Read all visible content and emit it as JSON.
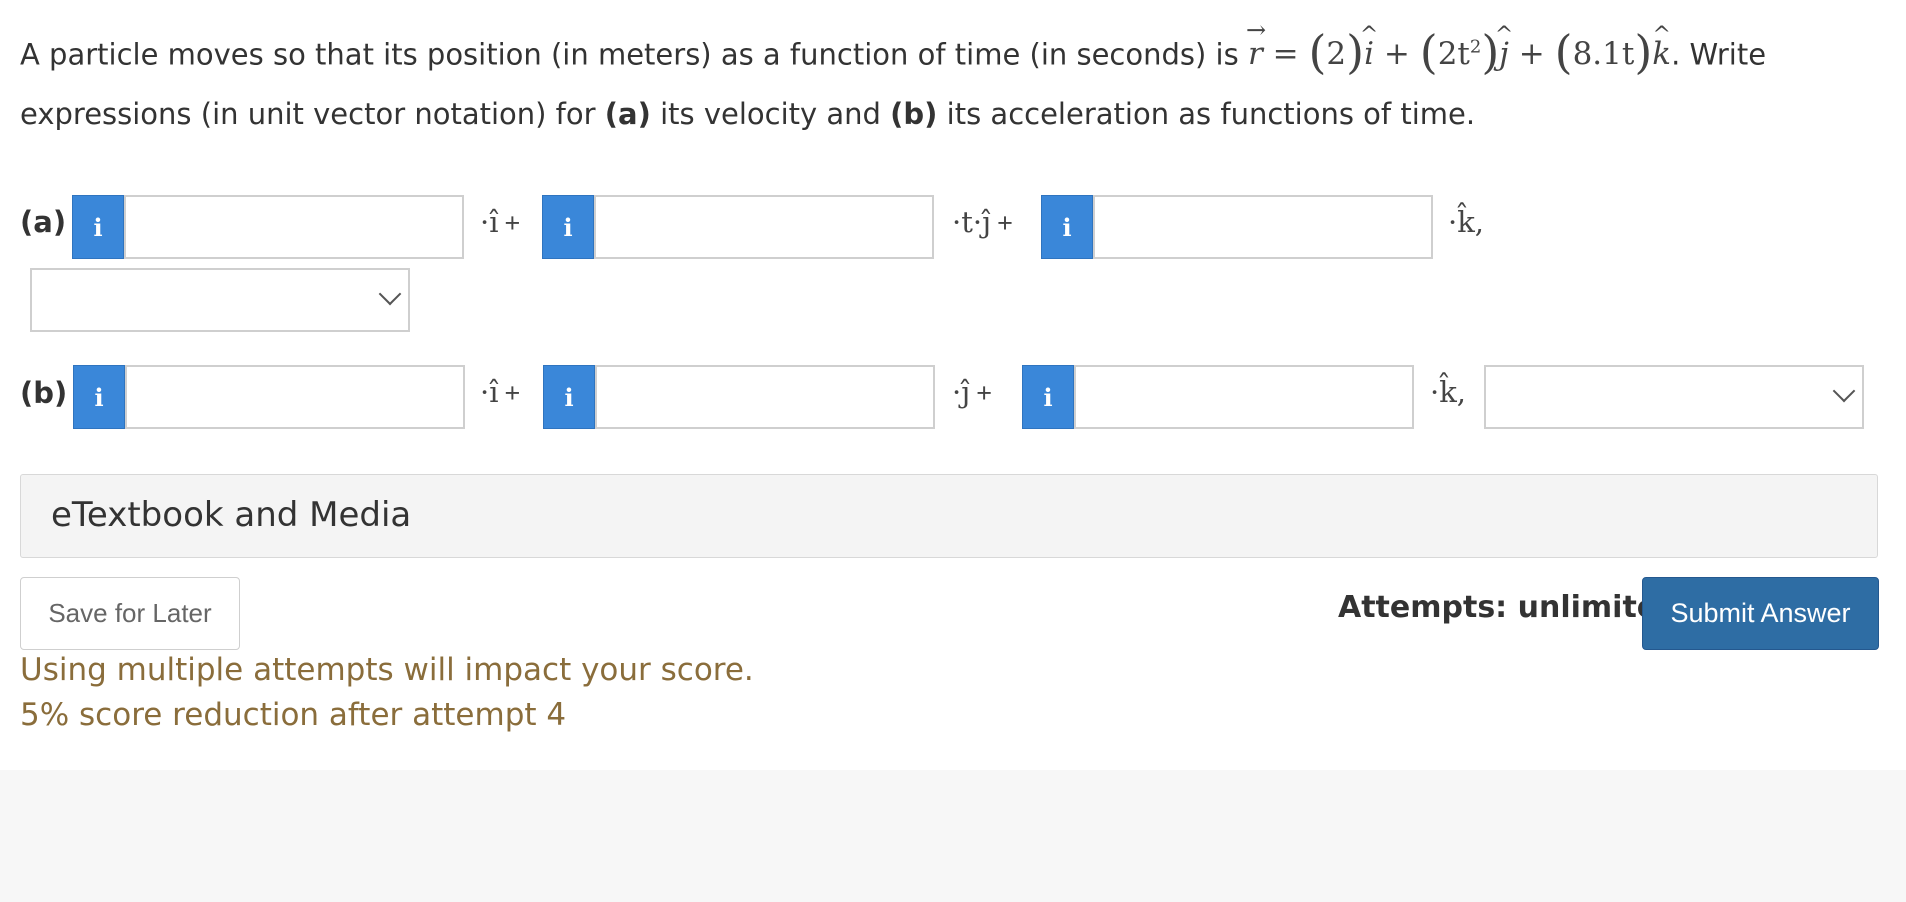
{
  "question": {
    "intro": "A particle moves so that its position (in meters) as a function of time (in seconds) is ",
    "r_symbol": "r",
    "equals": "=",
    "term1_coef": "2",
    "term2_coef": "2t",
    "term2_exp": "2",
    "term3_coef": "8.1t",
    "unit_i": "i",
    "unit_j": "j",
    "unit_k": "k",
    "plus": "+",
    "after_eq": ". Write",
    "line2_a": "expressions (in unit vector notation) for ",
    "part_a": "(a)",
    "line2_b": " its velocity and ",
    "part_b": "(b)",
    "line2_c": " its acceleration as functions of time."
  },
  "part_a": {
    "label": "(a)",
    "info_icon": "i",
    "unit1": "·î",
    "unit2": "·t·ĵ",
    "unit3": "·k̂,",
    "plus": "+",
    "input1": "",
    "input2": "",
    "input3": "",
    "units_select": ""
  },
  "part_b": {
    "label": "(b)",
    "info_icon": "i",
    "unit1": "·î",
    "unit2": "·ĵ",
    "unit3": "·k̂,",
    "plus": "+",
    "input1": "",
    "input2": "",
    "input3": "",
    "units_select": ""
  },
  "etextbook": {
    "label": "eTextbook and Media"
  },
  "footer": {
    "save_label": "Save for Later",
    "attempts_label": "Attempts: unlimited",
    "submit_label": "Submit Answer",
    "warning_line1": "Using multiple attempts will impact your score.",
    "warning_line2": "5% score reduction after attempt 4"
  },
  "colors": {
    "info_button": "#3a87d9",
    "submit_button": "#2e6da4",
    "warning_text": "#8a6d3b"
  }
}
